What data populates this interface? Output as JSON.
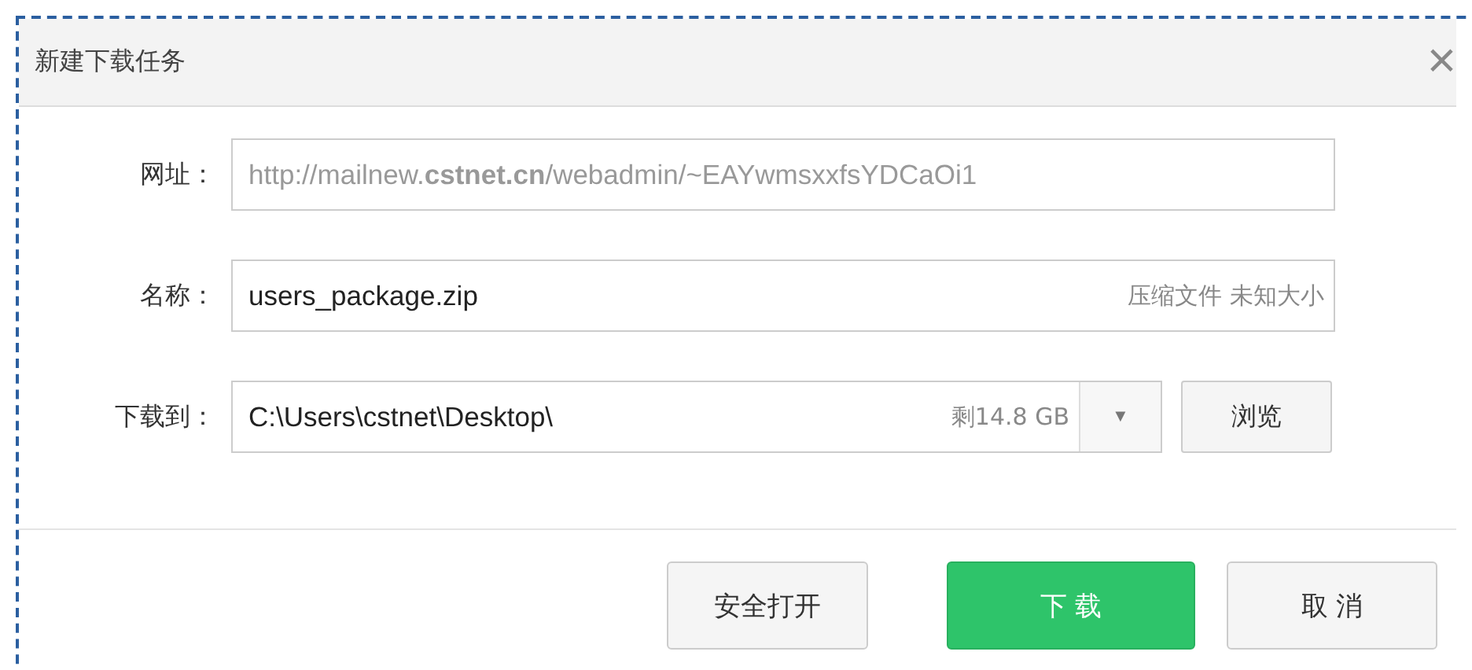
{
  "window": {
    "title": "新建下载任务",
    "close": "×"
  },
  "fields": [
    {
      "label": "网址：",
      "value": "http://mailnew.**cstnet.cn**/webadmin/~EAYwmsxxfsYDCaOi1",
      "muted": true
    },
    {
      "label": "名称：",
      "value": "users_package.zip",
      "muted": false,
      "hint": "压缩文件 未知大小"
    },
    {
      "label": "下载到：",
      "value": "C:\\Users\\cstnet\\Desktop\\",
      "muted": false,
      "hint": "剩14.8 GB",
      "dropdown": "▼",
      "button": "浏览"
    }
  ],
  "buttons": [
    {
      "label": "安全打开",
      "kind": "default"
    },
    {
      "label": "下 载",
      "kind": "primary"
    },
    {
      "label": "取 消",
      "kind": "default"
    }
  ]
}
